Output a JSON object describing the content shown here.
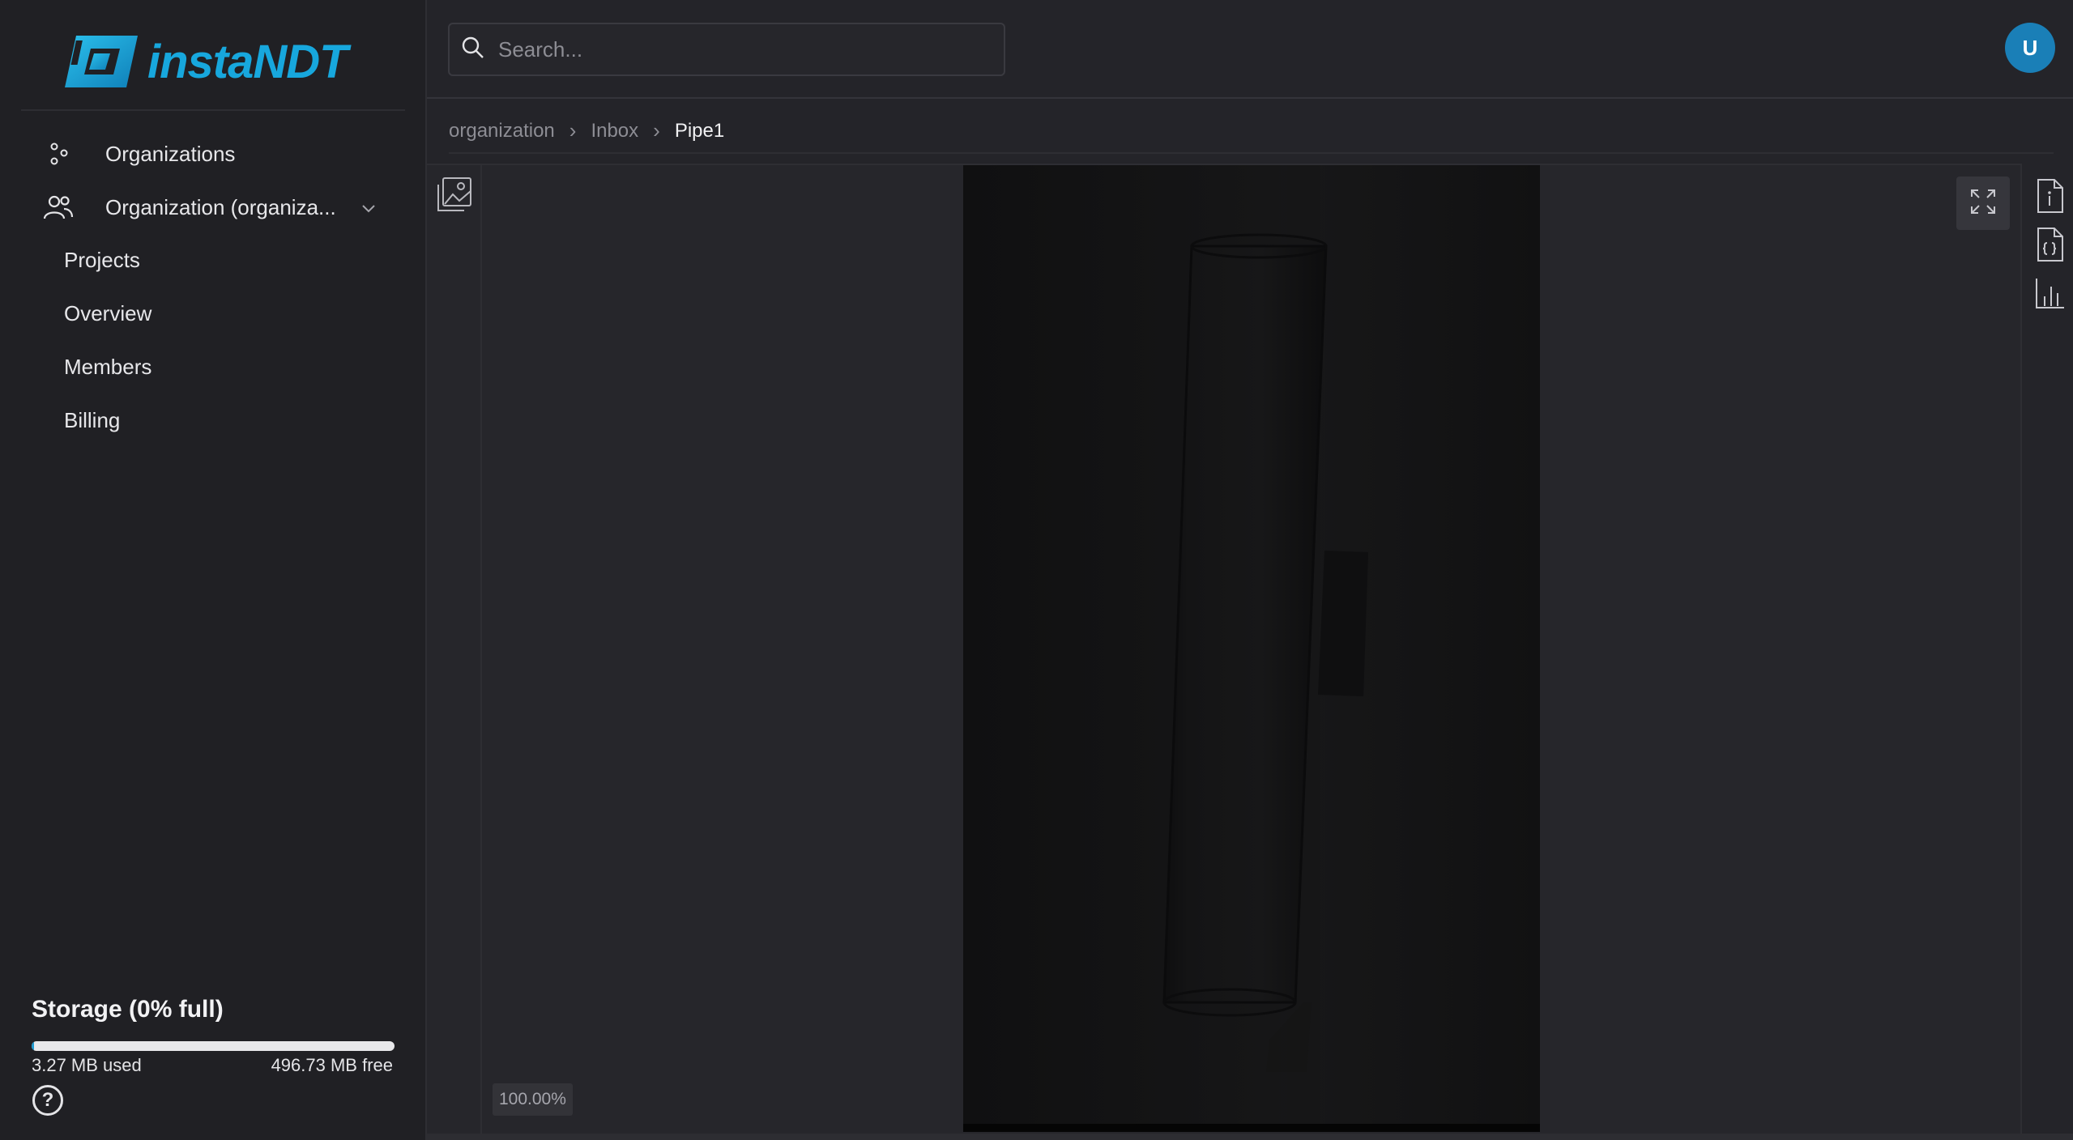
{
  "app": {
    "logo_text": "instaNDT",
    "brand_color": "#17a7dd"
  },
  "sidebar": {
    "items": [
      {
        "label": "Organizations",
        "icon": "organizations-icon"
      },
      {
        "label": "Organization (organiza...",
        "icon": "users-icon",
        "expanded": true
      }
    ],
    "subitems": [
      {
        "label": "Projects"
      },
      {
        "label": "Overview"
      },
      {
        "label": "Members"
      },
      {
        "label": "Billing"
      }
    ],
    "storage": {
      "title": "Storage (0% full)",
      "used": "3.27 MB used",
      "free": "496.73 MB free",
      "fill_fraction": 0.0065
    },
    "help_icon": "help-icon"
  },
  "header": {
    "search_placeholder": "Search...",
    "avatar_initial": "U",
    "avatar_color": "#1a7fb7"
  },
  "breadcrumb": {
    "items": [
      "organization",
      "Inbox",
      "Pipe1"
    ]
  },
  "viewer": {
    "zoom": "100.00%",
    "image_subject": "radiograph of pipe",
    "left_tool_icon": "image-gallery-icon",
    "expand_icon": "expand-icon",
    "right_tools": [
      "file-info-icon",
      "file-json-icon",
      "histogram-icon"
    ]
  }
}
